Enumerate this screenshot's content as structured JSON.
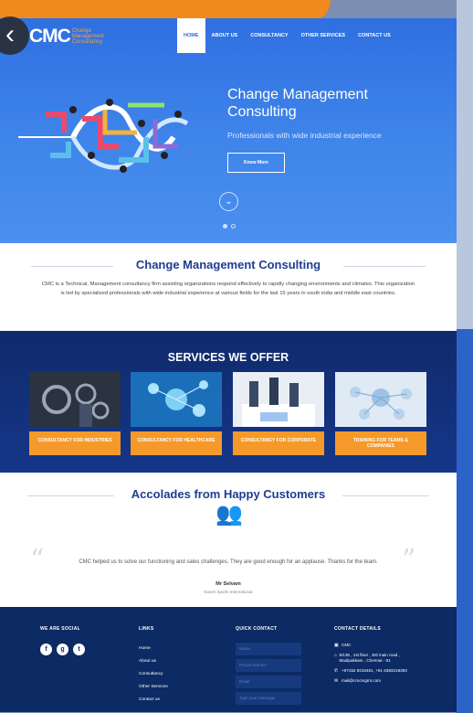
{
  "header": {
    "logo_mark": "CMC",
    "logo_sub": "Change Management Consultancy",
    "nav": [
      "HOME",
      "ABOUT US",
      "CONSULTANCY",
      "OTHER SERVICES",
      "CONTACT US"
    ]
  },
  "hero": {
    "title": "Change Management Consulting",
    "subtitle": "Professionals with wide industrial experience",
    "button": "Know More"
  },
  "intro": {
    "title": "Change Management Consulting",
    "text": "CMC is a Technical, Management consultancy firm assisting organizations respond effectively to rapidly changing environments and climates. This organization is led by specialized professionals with wide industrial experience at various fields for the last 15 years in south india and middle east countries."
  },
  "services": {
    "title": "SERVICES WE OFFER",
    "items": [
      "CONSULTANCY FOR INDUSTRIES",
      "CONSULTANCY FOR HEALTHCARE",
      "CONSULTANCY FOR CORPORATE",
      "TRAINING FOR TEAMS & COMPANIES"
    ]
  },
  "accolades": {
    "title": "Accolades from Happy Customers",
    "quote": "CMC helped us to solve our functioning and sales challenges. They are good enough for an applause. Thanks for the team.",
    "name": "Mr Selvam",
    "role": "Kaveri Sports International"
  },
  "footer": {
    "social_head": "WE ARE SOCIAL",
    "links_head": "LINKS",
    "links": [
      "Home",
      "About us",
      "Consultancy",
      "Other Services",
      "Contact us"
    ],
    "quick_head": "QUICK CONTACT",
    "quick_fields": [
      "Name",
      "Phone Number",
      "Email",
      "Type your message"
    ],
    "contact_head": "CONTACT DETAILS",
    "company": "CMC",
    "address": "5/135 , 1st floor , 3rd main road , Madipakkam , Chennai - 91",
    "phones": "+97152 9318461, +91 6383218393",
    "email": "mail@cmcmgmt.com"
  }
}
